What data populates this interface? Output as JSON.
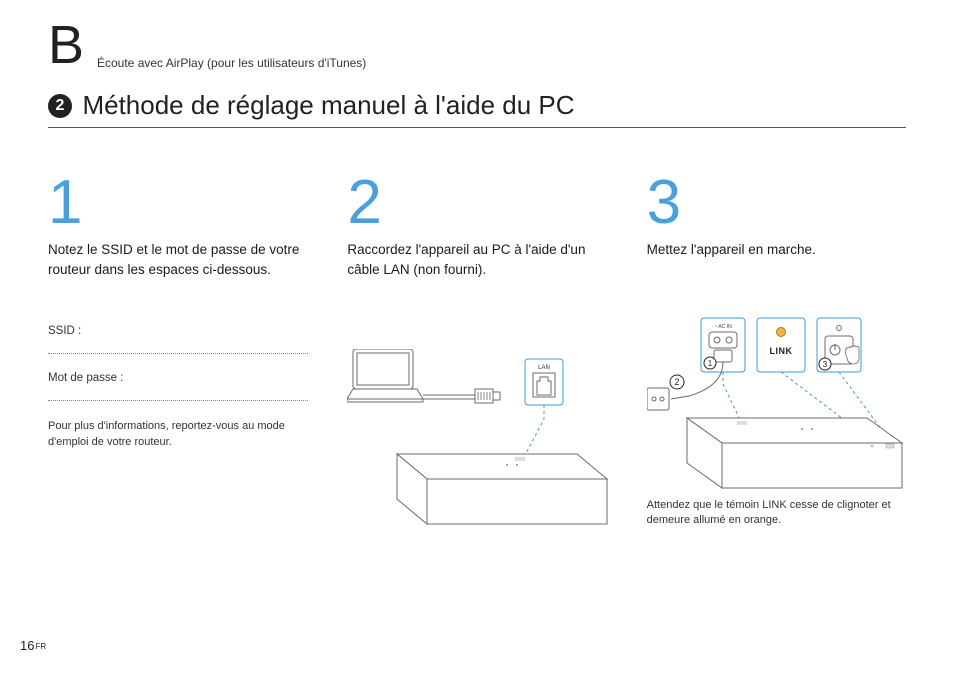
{
  "section": {
    "letter": "B",
    "subtitle": "Écoute avec AirPlay (pour les utilisateurs d'iTunes)"
  },
  "title": {
    "badge": "2",
    "text": "Méthode de réglage manuel à l'aide du PC"
  },
  "steps": {
    "s1": {
      "num": "1",
      "text": "Notez le SSID et le mot de passe de votre routeur dans les espaces ci-dessous.",
      "ssid_label": "SSID :",
      "password_label": "Mot de passe :",
      "router_note": "Pour plus d'informations, reportez-vous au mode d'emploi de votre routeur."
    },
    "s2": {
      "num": "2",
      "text": "Raccordez l'appareil au PC à l'aide d'un câble LAN (non fourni).",
      "lan_label": "LAN"
    },
    "s3": {
      "num": "3",
      "text": "Mettez l'appareil en marche.",
      "link_label": "LINK",
      "acin_label": "~ AC IN",
      "note": "Attendez que le témoin LINK cesse de clignoter et demeure allumé en orange."
    }
  },
  "page": {
    "number": "16",
    "lang": "FR"
  }
}
